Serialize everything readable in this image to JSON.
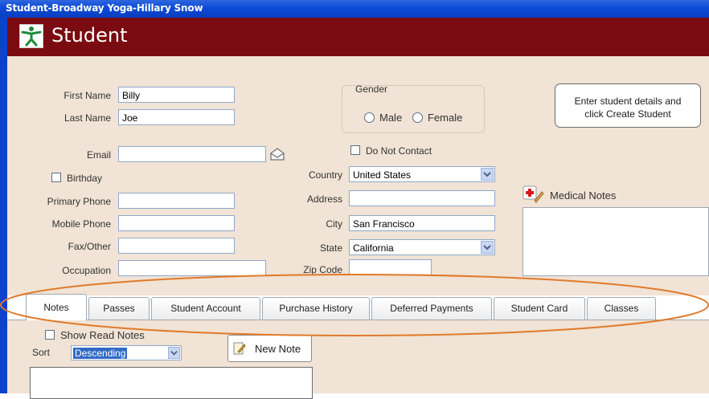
{
  "window": {
    "title": "Student-Broadway Yoga-Hillary Snow"
  },
  "header": {
    "title": "Student",
    "logo_icon": "yoga-figure-icon"
  },
  "form": {
    "first_name": {
      "label": "First Name",
      "value": "Billy"
    },
    "last_name": {
      "label": "Last Name",
      "value": "Joe"
    },
    "email": {
      "label": "Email",
      "value": "",
      "icon": "envelope-icon"
    },
    "birthday": {
      "label": "Birthday",
      "checked": false
    },
    "primary_phone": {
      "label": "Primary Phone",
      "value": ""
    },
    "mobile_phone": {
      "label": "Mobile Phone",
      "value": ""
    },
    "fax_other": {
      "label": "Fax/Other",
      "value": ""
    },
    "occupation": {
      "label": "Occupation",
      "value": ""
    },
    "gender": {
      "legend": "Gender",
      "options": [
        "Male",
        "Female"
      ],
      "selected": ""
    },
    "do_not_contact": {
      "label": "Do Not Contact",
      "checked": false
    },
    "country": {
      "label": "Country",
      "value": "United States"
    },
    "address": {
      "label": "Address",
      "value": ""
    },
    "city": {
      "label": "City",
      "value": "San Francisco"
    },
    "state": {
      "label": "State",
      "value": "California"
    },
    "zip_code": {
      "label": "Zip Code",
      "value": ""
    }
  },
  "tip": {
    "line1": "Enter student details and",
    "line2": "click Create Student"
  },
  "medical": {
    "label": "Medical Notes",
    "icon": "medical-cross-icon"
  },
  "tabs": [
    {
      "label": "Notes",
      "active": true
    },
    {
      "label": "Passes"
    },
    {
      "label": "Student Account"
    },
    {
      "label": "Purchase History"
    },
    {
      "label": "Deferred Payments"
    },
    {
      "label": "Student Card"
    },
    {
      "label": "Classes"
    }
  ],
  "notes": {
    "show_read_label": "Show Read Notes",
    "sort_label": "Sort",
    "sort_value": "Descending",
    "new_note_label": "New Note"
  },
  "colors": {
    "header_bg": "#7a0c11",
    "form_bg": "#f1e3d5",
    "highlight_ellipse": "#e07a2a",
    "titlebar": "#0b4bd6"
  }
}
